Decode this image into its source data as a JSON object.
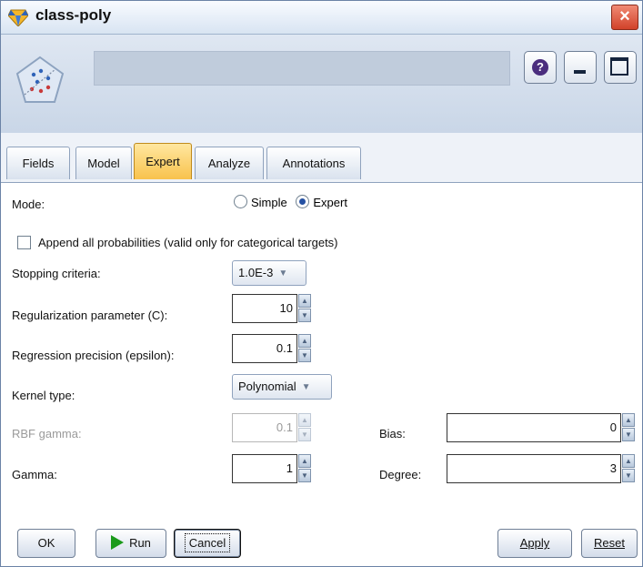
{
  "window": {
    "title": "class-poly",
    "close_glyph": "×",
    "help_glyph": "?"
  },
  "header": {
    "node_name": ""
  },
  "tabs": [
    {
      "label": "Fields"
    },
    {
      "label": "Model"
    },
    {
      "label": "Expert",
      "active": true
    },
    {
      "label": "Analyze"
    },
    {
      "label": "Annotations"
    }
  ],
  "form": {
    "mode_label": "Mode:",
    "mode_options": [
      "Simple",
      "Expert"
    ],
    "mode_selected": "Expert",
    "append_label": "Append all probabilities (valid only for categorical targets)",
    "append_checked": false,
    "stopping_label": "Stopping criteria:",
    "stopping_value": "1.0E-3",
    "regularization_label": "Regularization parameter (C):",
    "regularization_value": "10",
    "epsilon_label": "Regression precision (epsilon):",
    "epsilon_value": "0.1",
    "kernel_label": "Kernel type:",
    "kernel_value": "Polynomial",
    "rbf_label": "RBF gamma:",
    "rbf_value": "0.1",
    "bias_label": "Bias:",
    "bias_value": "0",
    "gamma_label": "Gamma:",
    "gamma_value": "1",
    "degree_label": "Degree:",
    "degree_value": "3"
  },
  "buttons": {
    "ok": "OK",
    "run": "Run",
    "cancel": "Cancel",
    "apply": "Apply",
    "reset": "Reset"
  },
  "icons": {
    "title_logo": "gem-icon",
    "node": "svm-model-node-icon",
    "help": "help-icon",
    "minimize": "minimize-icon",
    "maximize": "maximize-icon",
    "close": "close-icon",
    "run": "play-icon",
    "spin": "spinner-arrows-icon",
    "dropdown": "chevron-down-icon"
  },
  "colors": {
    "active_tab": "#f8c24c",
    "window_border": "#6b83a6",
    "close_button": "#d1422a",
    "run_icon": "#1b9a1b"
  }
}
